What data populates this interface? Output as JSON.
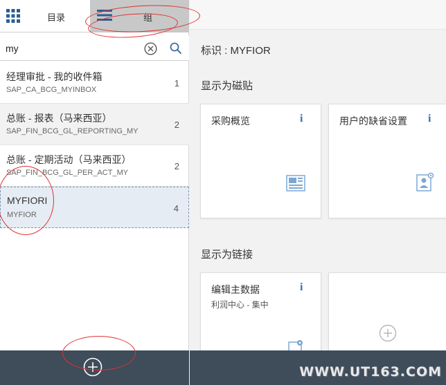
{
  "tabs": {
    "catalog_label": "目录",
    "groups_label": "组"
  },
  "search": {
    "value": "my"
  },
  "catalog_list": [
    {
      "title": "经理审批 - 我的收件箱",
      "id": "SAP_CA_BCG_MYINBOX",
      "count": "1"
    },
    {
      "title": "总账 - 报表（马来西亚）",
      "id": "SAP_FIN_BCG_GL_REPORTING_MY",
      "count": "2"
    },
    {
      "title": "总账 - 定期活动（马来西亚）",
      "id": "SAP_FIN_BCG_GL_PER_ACT_MY",
      "count": "2"
    },
    {
      "title": "MYFIORI",
      "id": "MYFIOR",
      "count": "4"
    }
  ],
  "detail": {
    "identity": "标识 : MYFIOR",
    "tiles_section": "显示为磁贴",
    "links_section": "显示为链接",
    "tiles": [
      {
        "title": "采购概览",
        "info": "i",
        "icon": "newspaper-icon"
      },
      {
        "title": "用户的缺省设置",
        "info": "i",
        "icon": "user-settings-icon"
      }
    ],
    "links": [
      {
        "title": "编辑主数据",
        "subtitle": "利润中心 - 集中",
        "info": "i",
        "icon": "document-settings-icon"
      }
    ],
    "add_tile_icon": "add-icon"
  },
  "watermark": "WWW.UT163.COM",
  "colors": {
    "accent": "#3a6fa8",
    "footer": "#3f4c5a",
    "annotation": "#e03030"
  }
}
